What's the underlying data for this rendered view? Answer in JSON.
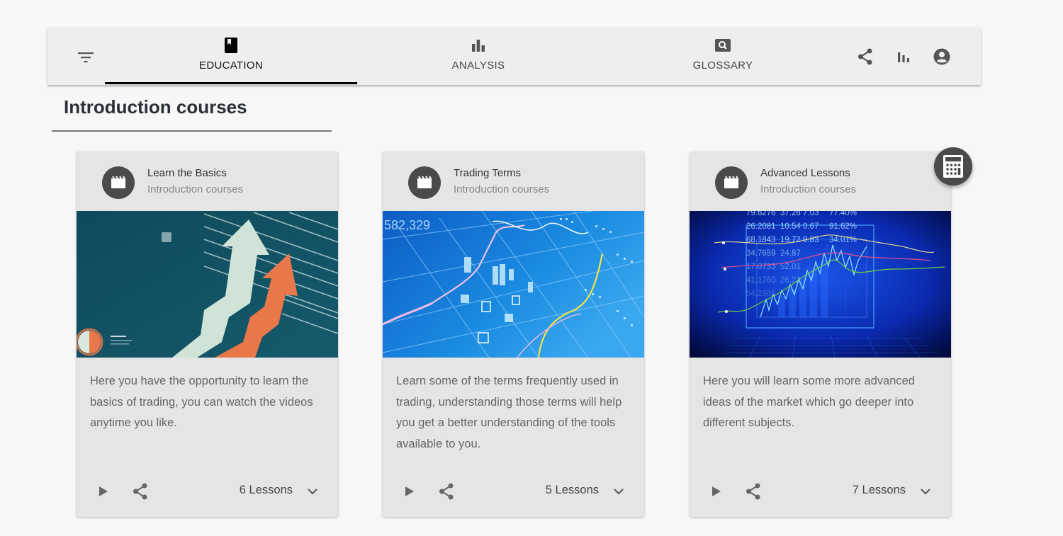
{
  "navbar": {
    "filter_icon": "filter-list-icon",
    "tabs": [
      {
        "label": "EDUCATION",
        "icon": "book-icon",
        "active": true
      },
      {
        "label": "ANALYSIS",
        "icon": "bar-chart-icon",
        "active": false
      },
      {
        "label": "GLOSSARY",
        "icon": "search-box-icon",
        "active": false
      }
    ],
    "actions": [
      {
        "icon": "share-icon"
      },
      {
        "icon": "bar-chart-icon"
      },
      {
        "icon": "account-circle-icon"
      }
    ]
  },
  "section": {
    "title": "Introduction courses"
  },
  "cards": [
    {
      "title": "Learn the Basics",
      "subtitle": "Introduction courses",
      "avatar_icon": "movie-clapper-icon",
      "image": "rising-arrows-illustration",
      "description": "Here you have the opportunity to learn the basics of trading, you can watch the videos anytime you like.",
      "lessons": "6 Lessons"
    },
    {
      "title": "Trading Terms",
      "subtitle": "Introduction courses",
      "avatar_icon": "movie-clapper-icon",
      "image": "candlestick-chart-illustration",
      "description": "Learn some of the terms frequently used in trading, understanding those terms will help you get a better understanding of the tools available to you.",
      "lessons": "5 Lessons"
    },
    {
      "title": "Advanced Lessons",
      "subtitle": "Introduction courses",
      "avatar_icon": "movie-clapper-icon",
      "image": "market-data-screen-illustration",
      "image_text": [
        "79.6276",
        "37.28",
        "7.03",
        "77.40%",
        "26.2081",
        "10.54",
        "0.67",
        "91.62%",
        "68.1843",
        "19.72",
        "9.83",
        "34.01%",
        "34.7659",
        "24.87",
        "41.1760",
        "26.22",
        "17.0733",
        "52.01",
        "54.2985"
      ],
      "description": "Here you will learn some more advanced ideas of the market which go deeper into different subjects.",
      "lessons": "7 Lessons"
    }
  ],
  "card2_image_text": "582,329",
  "fab": {
    "icon": "calculator-icon"
  },
  "colors": {
    "background": "#f7f7f7",
    "navbar": "#eeeeee",
    "card": "#e5e5e5",
    "avatar": "#4a4a4a",
    "active_indicator": "#000000"
  }
}
